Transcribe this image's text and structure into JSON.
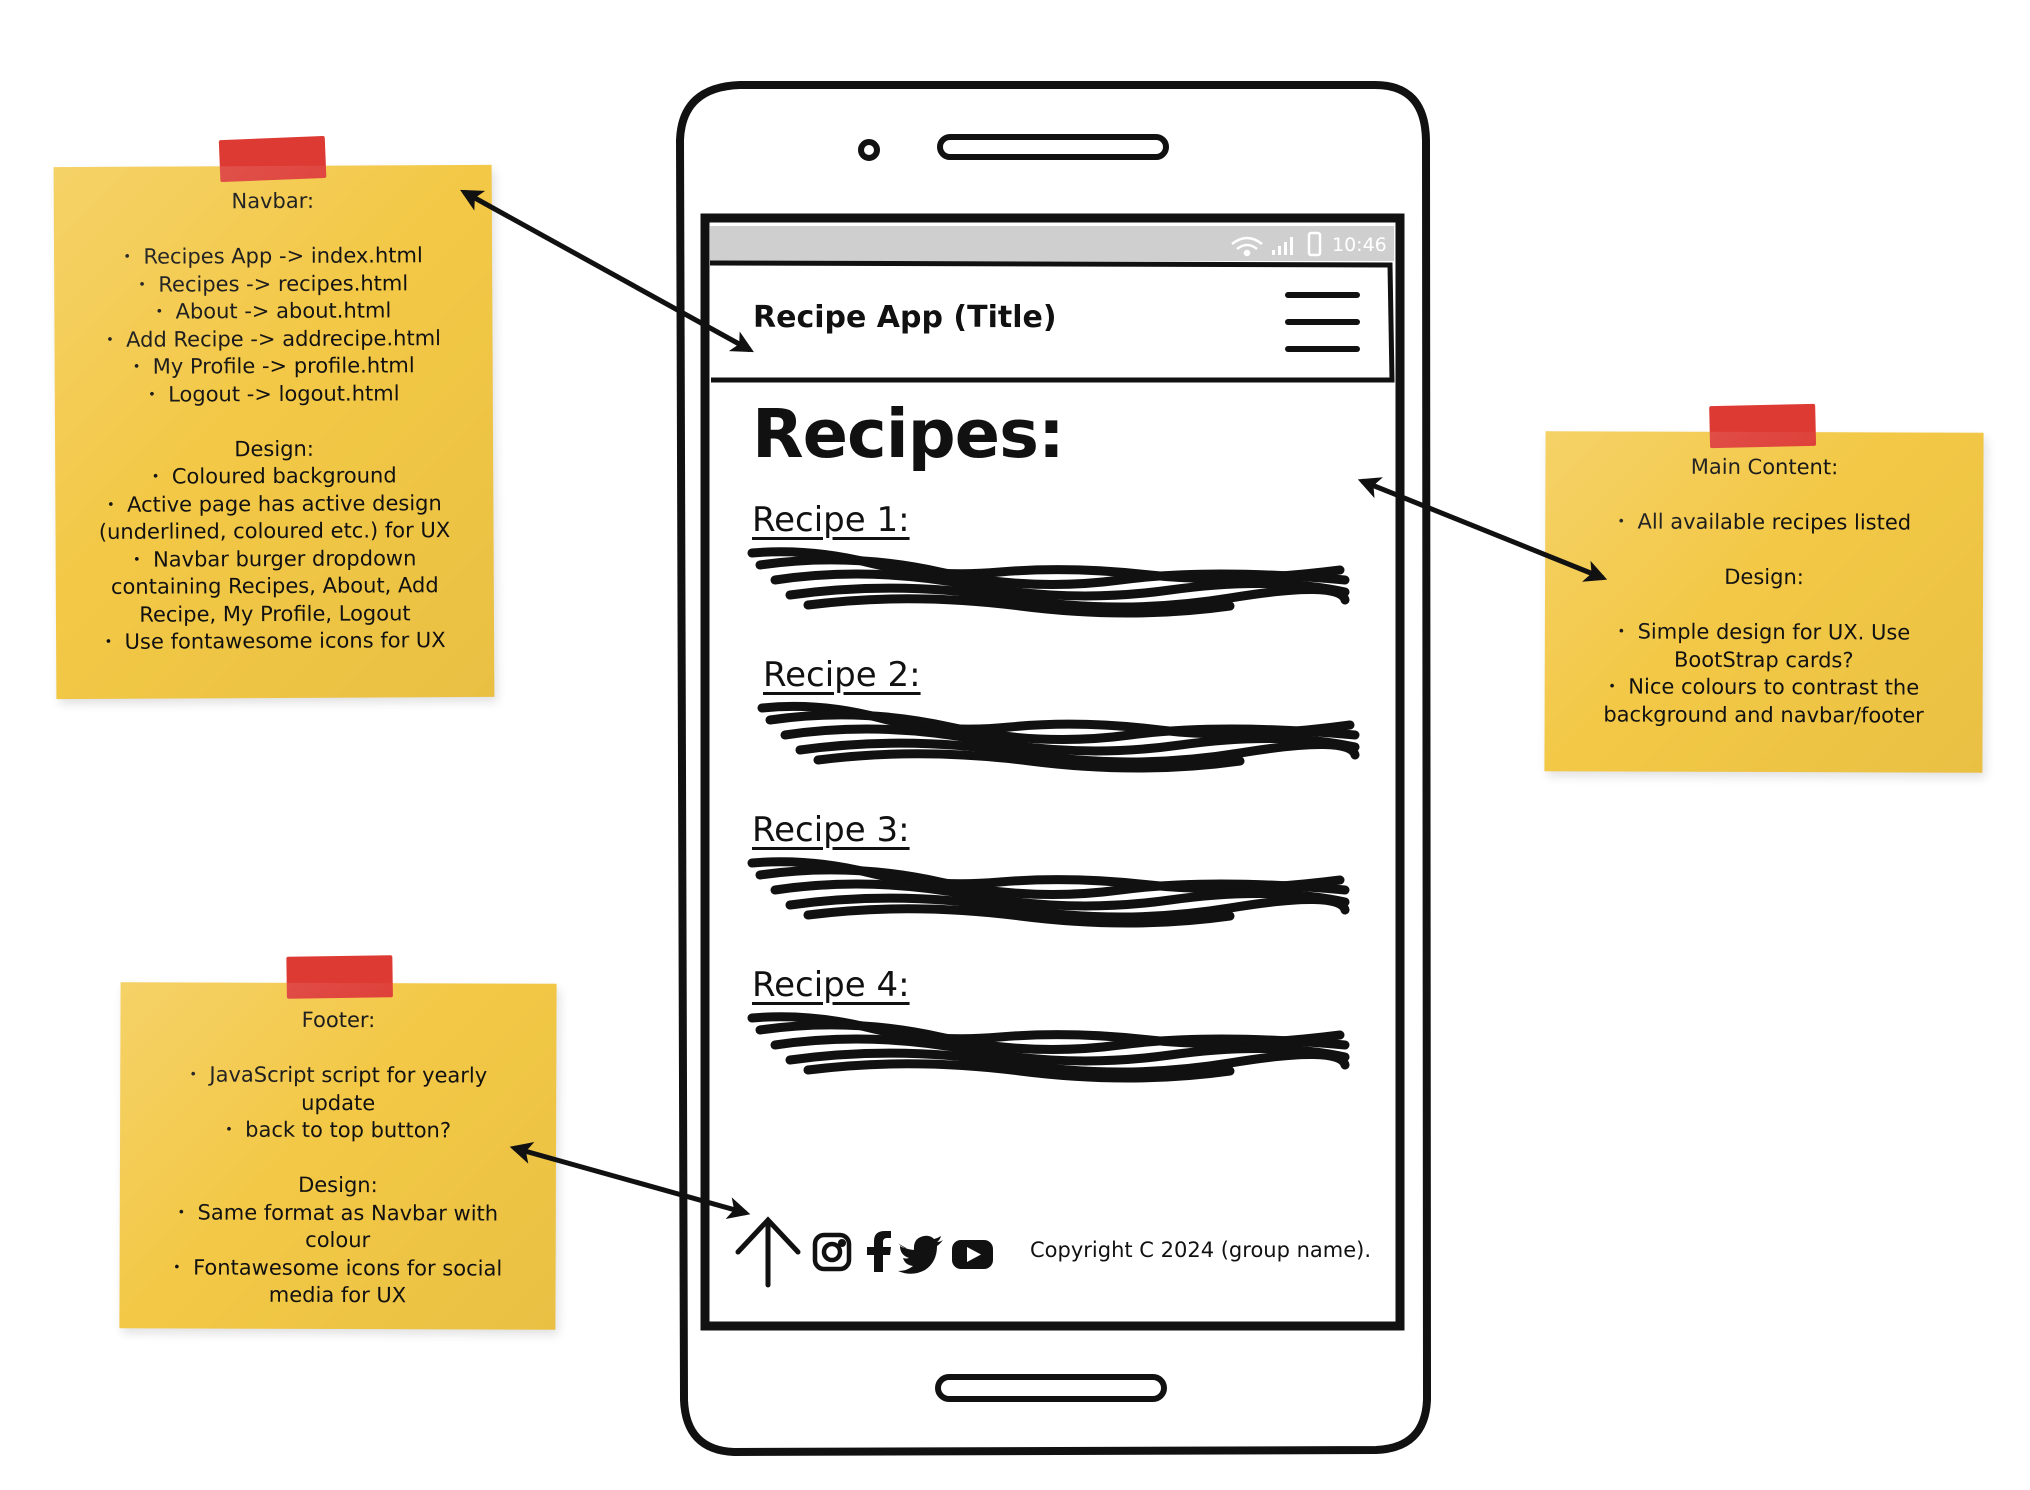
{
  "notes": {
    "navbar": {
      "heading": "Navbar:",
      "links": [
        "Recipes App -> index.html",
        "Recipes -> recipes.html",
        "About -> about.html",
        "Add Recipe -> addrecipe.html",
        "My Profile -> profile.html",
        "Logout -> logout.html"
      ],
      "design_heading": "Design:",
      "design": [
        "Coloured background",
        "Active page has active design",
        "(underlined, coloured etc.) for UX",
        "Navbar burger dropdown",
        "containing Recipes, About, Add",
        "Recipe, My Profile, Logout",
        "Use fontawesome icons for UX"
      ]
    },
    "main": {
      "heading": "Main Content:",
      "items": [
        "All available recipes listed"
      ],
      "design_heading": "Design:",
      "design": [
        "Simple design for UX. Use",
        "BootStrap cards?",
        "Nice colours to contrast the",
        "background and navbar/footer"
      ]
    },
    "footer": {
      "heading": "Footer:",
      "items": [
        "JavaScript script for yearly",
        "update",
        "back to top button?"
      ],
      "design_heading": "Design:",
      "design": [
        "Same format as Navbar with",
        "colour",
        "Fontawesome icons for social",
        "media for UX"
      ]
    }
  },
  "phone": {
    "status_time": "10:46",
    "app_title": "Recipe App (Title)",
    "page_heading": "Recipes:",
    "recipes": [
      "Recipe 1:",
      "Recipe 2:",
      "Recipe 3:",
      "Recipe 4:"
    ],
    "footer_icons": [
      "arrow-up-icon",
      "instagram-icon",
      "facebook-icon",
      "twitter-icon",
      "youtube-icon"
    ],
    "copyright": "Copyright C 2024 (group name)."
  },
  "colors": {
    "note": "#f3c846",
    "tape": "#dd3a33",
    "status_bar": "#cfcfcf"
  }
}
